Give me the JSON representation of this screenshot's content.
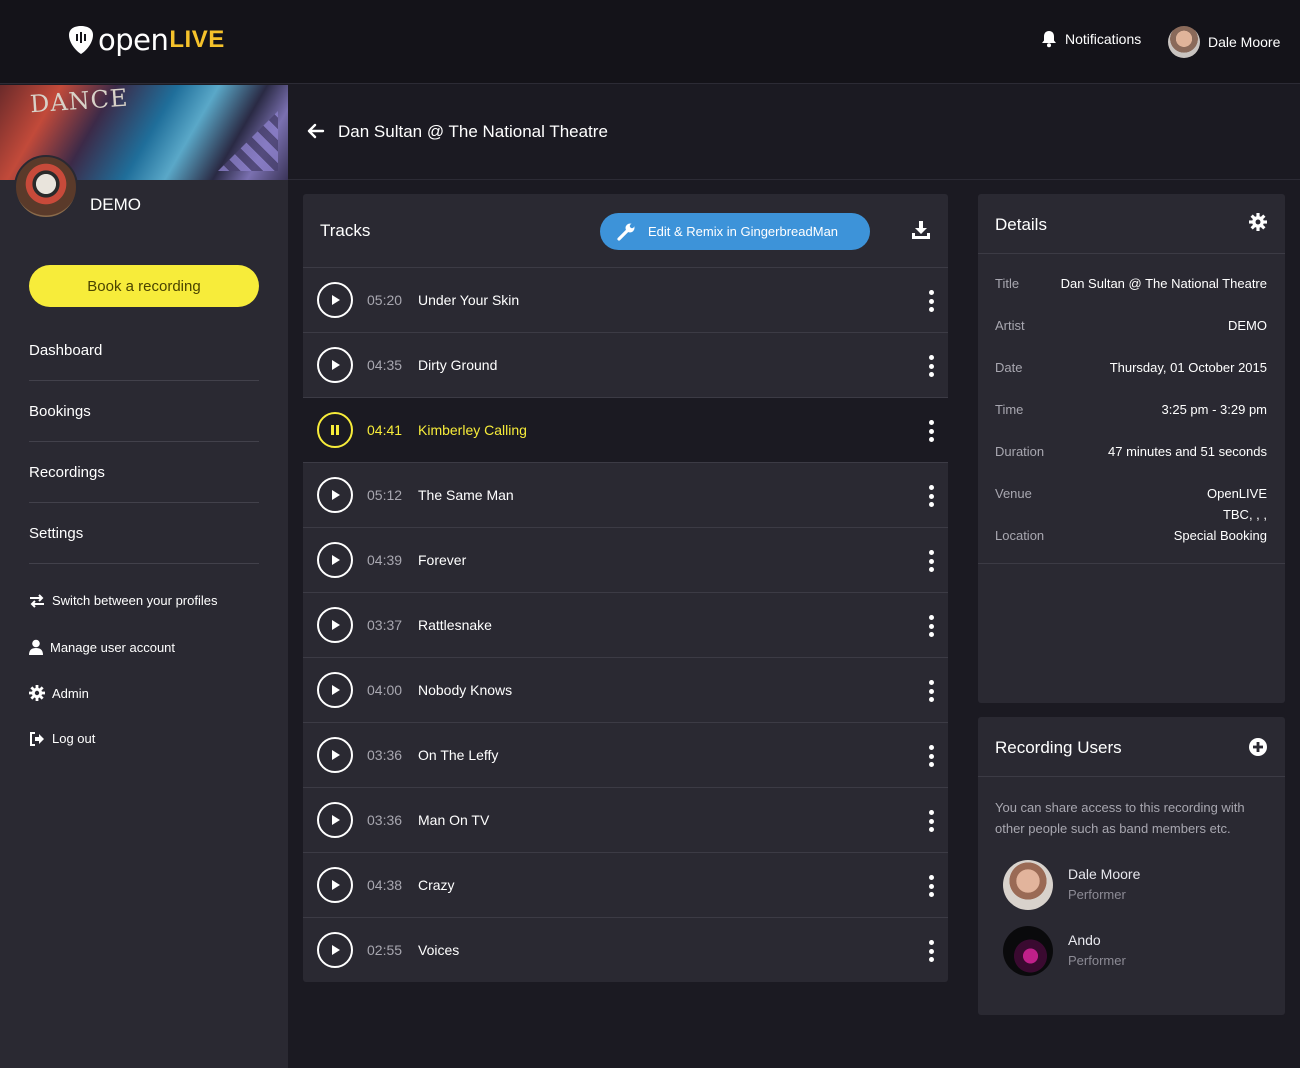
{
  "brand": {
    "open": "open",
    "live": "LIVE",
    "accent": "#f5c22b"
  },
  "topbar": {
    "notifications_label": "Notifications",
    "user_name": "Dale Moore"
  },
  "sidebar": {
    "banner_text": "DANCE",
    "profile_name": "DEMO",
    "book_label": "Book a recording",
    "nav": [
      {
        "label": "Dashboard"
      },
      {
        "label": "Bookings"
      },
      {
        "label": "Recordings"
      },
      {
        "label": "Settings"
      }
    ],
    "aux": [
      {
        "label": "Switch between your profiles",
        "icon": "switch-icon"
      },
      {
        "label": "Manage user account",
        "icon": "user-icon"
      },
      {
        "label": "Admin",
        "icon": "gear-icon"
      },
      {
        "label": "Log out",
        "icon": "logout-icon"
      }
    ]
  },
  "header": {
    "title": "Dan Sultan @ The National Theatre"
  },
  "tracks": {
    "title": "Tracks",
    "edit_label": "Edit & Remix in GingerbreadMan",
    "items": [
      {
        "duration": "05:20",
        "name": "Under Your Skin",
        "playing": false
      },
      {
        "duration": "04:35",
        "name": "Dirty Ground",
        "playing": false
      },
      {
        "duration": "04:41",
        "name": "Kimberley Calling",
        "playing": true
      },
      {
        "duration": "05:12",
        "name": "The Same Man",
        "playing": false
      },
      {
        "duration": "04:39",
        "name": "Forever",
        "playing": false
      },
      {
        "duration": "03:37",
        "name": "Rattlesnake",
        "playing": false
      },
      {
        "duration": "04:00",
        "name": "Nobody Knows",
        "playing": false
      },
      {
        "duration": "03:36",
        "name": "On The Leffy",
        "playing": false
      },
      {
        "duration": "03:36",
        "name": "Man On TV",
        "playing": false
      },
      {
        "duration": "04:38",
        "name": "Crazy",
        "playing": false
      },
      {
        "duration": "02:55",
        "name": "Voices",
        "playing": false
      }
    ]
  },
  "details": {
    "title": "Details",
    "rows": {
      "title": {
        "label": "Title",
        "value": "Dan Sultan @ The National Theatre"
      },
      "artist": {
        "label": "Artist",
        "value": "DEMO"
      },
      "date": {
        "label": "Date",
        "value": "Thursday, 01 October 2015"
      },
      "time": {
        "label": "Time",
        "value": "3:25 pm - 3:29 pm"
      },
      "duration": {
        "label": "Duration",
        "value": "47 minutes and 51 seconds"
      },
      "venue": {
        "label": "Venue",
        "value_line1": "OpenLIVE",
        "value_line2": "TBC, , ,"
      },
      "location": {
        "label": "Location",
        "value": "Special Booking"
      }
    }
  },
  "recording_users": {
    "title": "Recording Users",
    "description": "You can share access to this recording with other people such as band members etc.",
    "users": [
      {
        "name": "Dale Moore",
        "role": "Performer"
      },
      {
        "name": "Ando",
        "role": "Performer"
      }
    ]
  },
  "colors": {
    "primary_yellow": "#f7ec3a",
    "button_blue": "#3d93d9",
    "panel": "#2a2932",
    "background": "#1b1a22"
  }
}
